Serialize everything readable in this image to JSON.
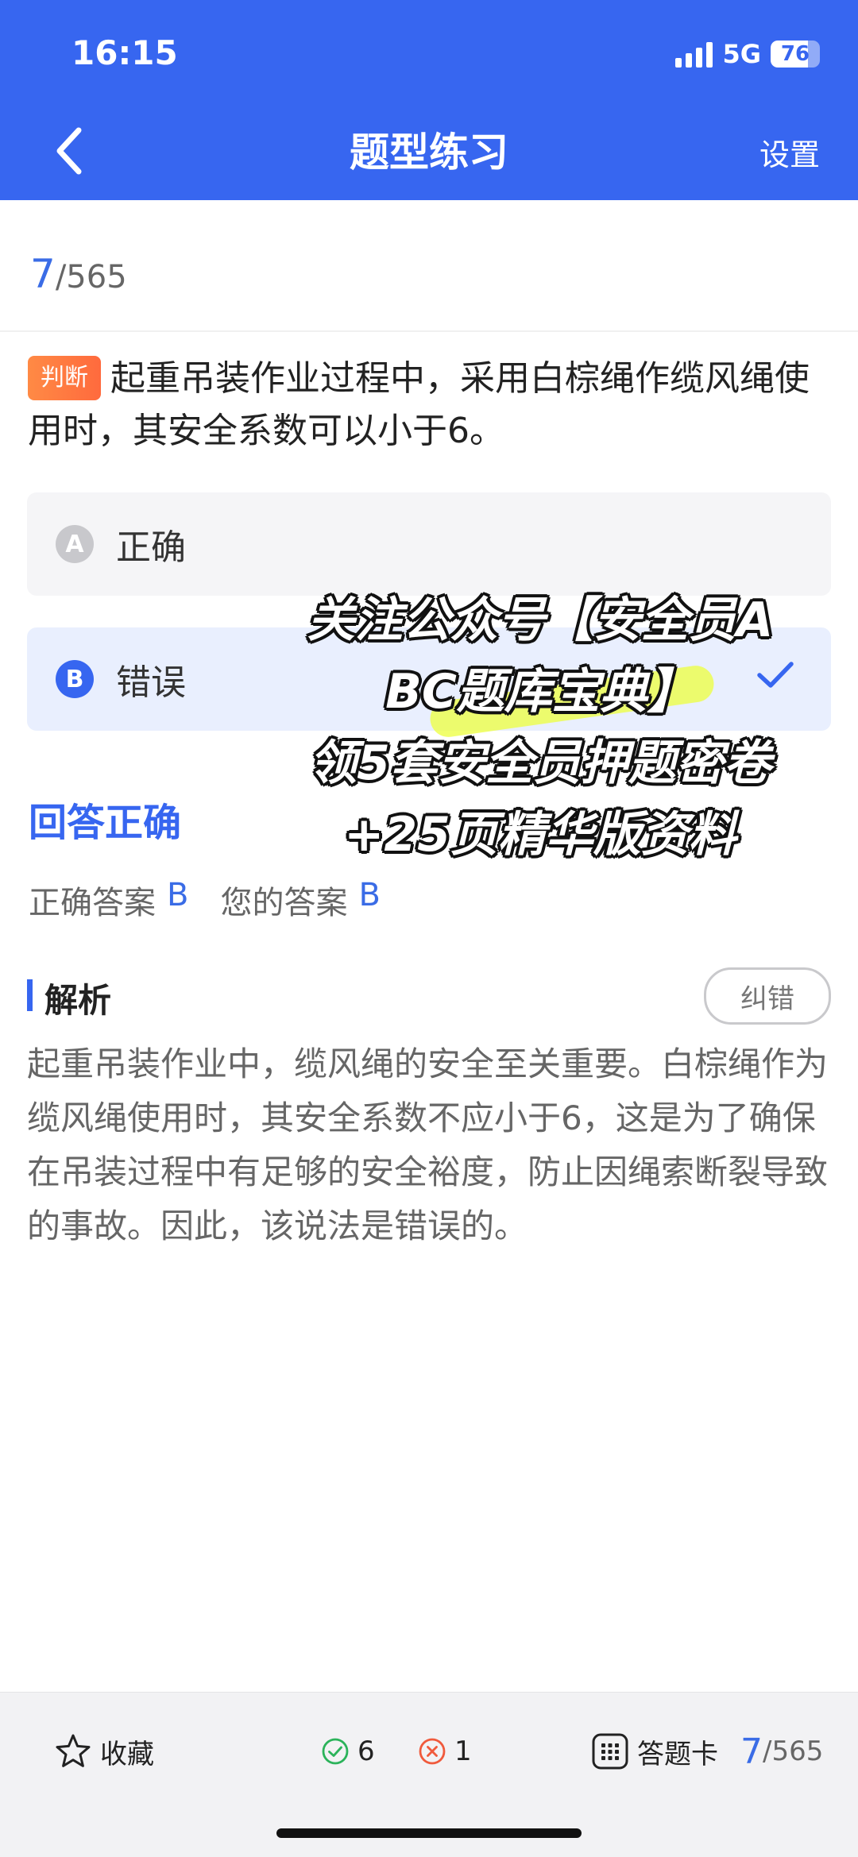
{
  "status_bar": {
    "time": "16:15",
    "network": "5G",
    "battery": "76",
    "battery_level": 0.76
  },
  "nav": {
    "title": "题型练习",
    "settings_label": "设置"
  },
  "progress": {
    "current": "7",
    "total": "/565"
  },
  "question": {
    "type_tag": "判断",
    "text": "起重吊装作业过程中，采用白棕绳作缆风绳使用时，其安全系数可以小于6。"
  },
  "options": [
    {
      "letter": "A",
      "text": "正确",
      "selected": false
    },
    {
      "letter": "B",
      "text": "错误",
      "selected": true
    }
  ],
  "result": {
    "title": "回答正确",
    "correct_label": "正确答案",
    "correct_value": "B",
    "yours_label": "您的答案",
    "yours_value": "B"
  },
  "analysis": {
    "title": "解析",
    "report_button": "纠错",
    "text": "起重吊装作业中，缆风绳的安全至关重要。白棕绳作为缆风绳使用时，其安全系数不应小于6，这是为了确保在吊装过程中有足够的安全裕度，防止因绳索断裂导致的事故。因此，该说法是错误的。"
  },
  "watermark": {
    "lines": [
      "关注公众号【安全员A",
      "BC题库宝典】",
      "领5套安全员押题密卷",
      "+25页精华版资料"
    ]
  },
  "toolbar": {
    "favorite_label": "收藏",
    "right_count": "6",
    "wrong_count": "1",
    "answer_card_label": "答题卡",
    "progress_current": "7",
    "progress_total": "/565"
  },
  "colors": {
    "primary": "#3766f0",
    "tag_orange": "#ff7a40",
    "right_green": "#2bb35a",
    "wrong_red": "#f05a3c"
  }
}
